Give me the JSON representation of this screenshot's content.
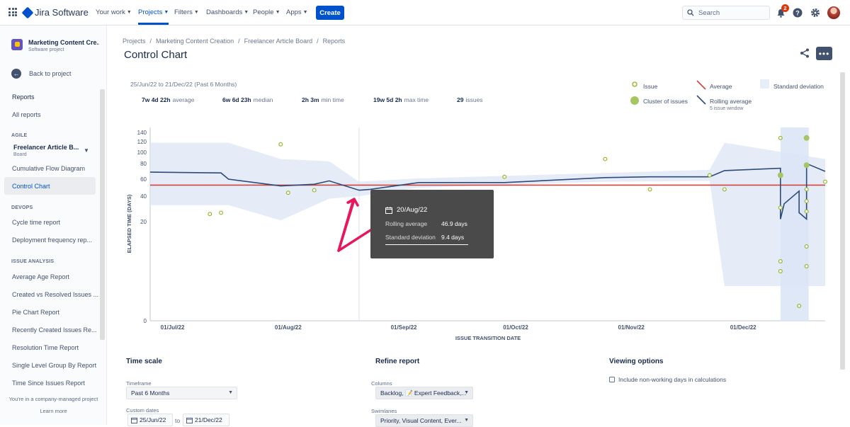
{
  "app": {
    "name": "Jira Software"
  },
  "topnav": {
    "items": [
      {
        "label": "Your work"
      },
      {
        "label": "Projects"
      },
      {
        "label": "Filters"
      },
      {
        "label": "Dashboards"
      },
      {
        "label": "People"
      },
      {
        "label": "Apps"
      }
    ],
    "create_label": "Create",
    "search_placeholder": "Search",
    "notification_count": "2"
  },
  "sidebar": {
    "project_name": "Marketing Content Cre...",
    "project_type": "Software project",
    "back_label": "Back to project",
    "reports_heading": "Reports",
    "all_reports": "All reports",
    "agile_heading": "AGILE",
    "board_name": "Freelancer Article B...",
    "board_type": "Board",
    "agile_items": [
      "Cumulative Flow Diagram",
      "Control Chart"
    ],
    "devops_heading": "DEVOPS",
    "devops_items": [
      "Cycle time report",
      "Deployment frequency rep..."
    ],
    "issue_heading": "ISSUE ANALYSIS",
    "issue_items": [
      "Average Age Report",
      "Created vs Resolved Issues ...",
      "Pie Chart Report",
      "Recently Created Issues Re...",
      "Resolution Time Report",
      "Single Level Group By Report",
      "Time Since Issues Report"
    ],
    "footer_text": "You're in a company-managed project",
    "footer_link": "Learn more"
  },
  "breadcrumbs": [
    "Projects",
    "Marketing Content Creation",
    "Freelancer Article Board",
    "Reports"
  ],
  "page_title": "Control Chart",
  "summary": {
    "range": "25/Jun/22 to 21/Dec/22 (Past 6 Months)",
    "stats": [
      {
        "value": "7w 4d 22h",
        "label": "average"
      },
      {
        "value": "6w 6d 23h",
        "label": "median"
      },
      {
        "value": "2h 3m",
        "label": "min time"
      },
      {
        "value": "19w 5d 2h",
        "label": "max time"
      },
      {
        "value": "29",
        "label": "issues"
      }
    ]
  },
  "legend": {
    "issue": "Issue",
    "cluster": "Cluster of issues",
    "average": "Average",
    "rolling": "Rolling average",
    "rolling_sub": "5 issue window",
    "stddev": "Standard deviation"
  },
  "colors": {
    "issue": "#8BB31D",
    "cluster": "#A5C663",
    "average": "#D0453C",
    "rolling": "#2C4A7A",
    "stddev_band": "#DCE6F5",
    "tooltip_bg": "#4A4A4A",
    "annotation": "#E8175D"
  },
  "chart_data": {
    "type": "scatter",
    "ylabel": "ELAPSED TIME (DAYS)",
    "xlabel": "ISSUE TRANSITION DATE",
    "y_ticks": [
      "140",
      "120",
      "100",
      "80",
      "60",
      "40",
      "20",
      "0"
    ],
    "x_ticks": [
      "01/Jul/22",
      "01/Aug/22",
      "01/Sep/22",
      "01/Oct/22",
      "01/Nov/22",
      "01/Dec/22"
    ],
    "average_days": 53,
    "issues": [
      {
        "date": "2022-07-11",
        "days": 26
      },
      {
        "date": "2022-07-14",
        "days": 27
      },
      {
        "date": "2022-07-30",
        "days": 115
      },
      {
        "date": "2022-08-01",
        "days": 44
      },
      {
        "date": "2022-08-08",
        "days": 47
      },
      {
        "date": "2022-09-08",
        "days": 44
      },
      {
        "date": "2022-09-28",
        "days": 63
      },
      {
        "date": "2022-10-25",
        "days": 88
      },
      {
        "date": "2022-11-06",
        "days": 48
      },
      {
        "date": "2022-11-22",
        "days": 65
      },
      {
        "date": "2022-11-26",
        "days": 48
      },
      {
        "date": "2022-12-11",
        "days": 128
      },
      {
        "date": "2022-12-11",
        "days": 31
      },
      {
        "date": "2022-12-11",
        "days": 12
      },
      {
        "date": "2022-12-11",
        "days": 10
      },
      {
        "date": "2022-12-16",
        "days": 3
      },
      {
        "date": "2022-12-18",
        "days": 48
      },
      {
        "date": "2022-12-18",
        "days": 36
      },
      {
        "date": "2022-12-18",
        "days": 28
      },
      {
        "date": "2022-12-18",
        "days": 15
      },
      {
        "date": "2022-12-18",
        "days": 11
      },
      {
        "date": "2022-12-23",
        "days": 57
      }
    ],
    "clusters": [
      {
        "date": "2022-12-11",
        "days": 65
      },
      {
        "date": "2022-12-18",
        "days": 128
      },
      {
        "date": "2022-12-18",
        "days": 78
      }
    ],
    "rolling_average": [
      {
        "date": "2022-06-25",
        "days": 69
      },
      {
        "date": "2022-07-14",
        "days": 68
      },
      {
        "date": "2022-07-16",
        "days": 60
      },
      {
        "date": "2022-07-30",
        "days": 52
      },
      {
        "date": "2022-08-08",
        "days": 54
      },
      {
        "date": "2022-08-12",
        "days": 58
      },
      {
        "date": "2022-08-20",
        "days": 47
      },
      {
        "date": "2022-08-23",
        "days": 48
      },
      {
        "date": "2022-09-05",
        "days": 56
      },
      {
        "date": "2022-09-28",
        "days": 56
      },
      {
        "date": "2022-10-25",
        "days": 62
      },
      {
        "date": "2022-11-06",
        "days": 63
      },
      {
        "date": "2022-11-22",
        "days": 63
      },
      {
        "date": "2022-11-26",
        "days": 71
      },
      {
        "date": "2022-12-11",
        "days": 74
      },
      {
        "date": "2022-12-11",
        "days": 22
      },
      {
        "date": "2022-12-12",
        "days": 34
      },
      {
        "date": "2022-12-16",
        "days": 46
      },
      {
        "date": "2022-12-16",
        "days": 27
      },
      {
        "date": "2022-12-18",
        "days": 22
      },
      {
        "date": "2022-12-18",
        "days": 80
      },
      {
        "date": "2022-12-23",
        "days": 70
      }
    ],
    "std_upper": [
      {
        "date": "2022-06-25",
        "days": 118
      },
      {
        "date": "2022-07-16",
        "days": 118
      },
      {
        "date": "2022-07-30",
        "days": 88
      },
      {
        "date": "2022-08-12",
        "days": 84
      },
      {
        "date": "2022-08-20",
        "days": 57
      },
      {
        "date": "2022-09-05",
        "days": 61
      },
      {
        "date": "2022-10-25",
        "days": 68
      },
      {
        "date": "2022-11-22",
        "days": 72
      },
      {
        "date": "2022-11-26",
        "days": 118
      },
      {
        "date": "2022-12-23",
        "days": 88
      }
    ],
    "std_lower": [
      {
        "date": "2022-12-23",
        "days": 7
      },
      {
        "date": "2022-11-26",
        "days": 7
      },
      {
        "date": "2022-11-22",
        "days": 58
      },
      {
        "date": "2022-10-25",
        "days": 57
      },
      {
        "date": "2022-09-05",
        "days": 50
      },
      {
        "date": "2022-08-20",
        "days": 40
      },
      {
        "date": "2022-08-12",
        "days": 38
      },
      {
        "date": "2022-07-30",
        "days": 21
      },
      {
        "date": "2022-07-16",
        "days": 33
      },
      {
        "date": "2022-06-25",
        "days": 33
      }
    ],
    "hover_date": "2022-08-20"
  },
  "tooltip": {
    "date": "20/Aug/22",
    "rows": [
      {
        "label": "Rolling average",
        "value": "46.9 days"
      },
      {
        "label": "Standard deviation",
        "value": "9.4 days"
      }
    ]
  },
  "timescale": {
    "title": "Time scale",
    "timeframe_label": "Timeframe",
    "timeframe_value": "Past 6 Months",
    "custom_label": "Custom dates",
    "from": "25/Jun/22",
    "to_word": "to",
    "to": "21/Dec/22"
  },
  "refine": {
    "title": "Refine report",
    "columns_label": "Columns",
    "columns_value": "Backlog, 📝 Expert Feedback,...",
    "swimlanes_label": "Swimlanes",
    "swimlanes_value": "Priority, Visual Content, Ever..."
  },
  "viewing": {
    "title": "Viewing options",
    "checkbox_label": "Include non-working days in calculations"
  }
}
